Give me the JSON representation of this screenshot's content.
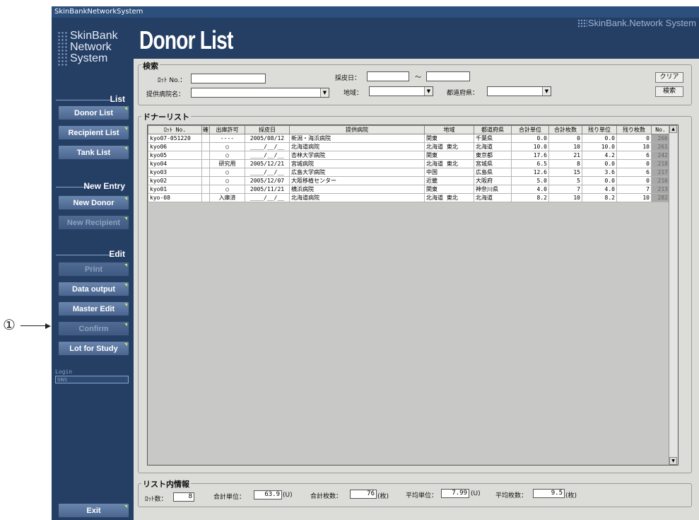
{
  "window": {
    "title": "SkinBankNetworkSystem"
  },
  "sidebar": {
    "logo": [
      "SkinBank",
      "Network",
      "System"
    ],
    "sections": {
      "list": "List",
      "new_entry": "New Entry",
      "edit": "Edit"
    },
    "buttons": {
      "donor_list": "Donor List",
      "recipient_list": "Recipient List",
      "tank_list": "Tank List",
      "new_donor": "New Donor",
      "new_recipient": "New Recipient",
      "print": "Print",
      "data_output": "Data output",
      "master_edit": "Master Edit",
      "confirm": "Confirm",
      "lot_for_study": "Lot for Study",
      "exit": "Exit"
    },
    "login_label": "Login",
    "login_value": "SNS"
  },
  "annotation": {
    "marker": "①"
  },
  "header": {
    "title": "Donor List",
    "brand": "SkinBank.Network System"
  },
  "search": {
    "group_label": "検索",
    "lot_label": "ﾛｯﾄ No.：",
    "lot_value": "",
    "date_label": "採皮日：",
    "date_from": "",
    "date_sep": "～",
    "date_to": "",
    "hospital_label": "提供病院名：",
    "hospital_value": "",
    "region_label": "地域：",
    "region_value": "",
    "prefecture_label": "都道府県：",
    "prefecture_value": "",
    "clear_button": "クリア",
    "search_button": "検索"
  },
  "list": {
    "group_label": "ドナーリスト",
    "columns": [
      "ﾛｯﾄ No.",
      "確",
      "出庫許可",
      "採皮日",
      "提供病院",
      "地域",
      "都道府県",
      "合計単位",
      "合計枚数",
      "残り単位",
      "残り枚数",
      "No."
    ],
    "rows": [
      [
        "kyo07-051220",
        "",
        "----",
        "2005/08/12",
        "新潟・海浜病院",
        "関東",
        "千葉県",
        "0.0",
        "0",
        "0.0",
        "0",
        "266"
      ],
      [
        "kyo06",
        "",
        "○",
        "____/__/__",
        "北海道病院",
        "北海道 東北",
        "北海道",
        "10.0",
        "10",
        "10.0",
        "10",
        "261"
      ],
      [
        "kyo05",
        "",
        "○",
        "____/__/__",
        "杏林大学病院",
        "関東",
        "東京都",
        "17.6",
        "21",
        "4.2",
        "6",
        "242"
      ],
      [
        "kyo04",
        "",
        "研究用",
        "2005/12/21",
        "宮城病院",
        "北海道 東北",
        "宮城県",
        "6.5",
        "8",
        "0.0",
        "0",
        "218"
      ],
      [
        "kyo03",
        "",
        "○",
        "____/__/__",
        "広島大学病院",
        "中国",
        "広島県",
        "12.6",
        "15",
        "3.6",
        "6",
        "217"
      ],
      [
        "kyo02",
        "",
        "○",
        "2005/12/07",
        "大阪移植センター",
        "近畿",
        "大阪府",
        "5.0",
        "5",
        "0.0",
        "0",
        "216"
      ],
      [
        "kyo01",
        "",
        "○",
        "2005/11/21",
        "横浜病院",
        "関東",
        "神奈川県",
        "4.0",
        "7",
        "4.0",
        "7",
        "213"
      ],
      [
        "kyo-08",
        "",
        "入庫済",
        "____/__/__",
        "北海道病院",
        "北海道 東北",
        "北海道",
        "8.2",
        "10",
        "8.2",
        "10",
        "282"
      ]
    ]
  },
  "info": {
    "group_label": "リスト内情報",
    "lot_count_label": "ﾛｯﾄ数：",
    "lot_count": "8",
    "total_units_label": "合計単位：",
    "total_units": "63.9",
    "total_units_unit": "(U)",
    "total_sheets_label": "合計枚数：",
    "total_sheets": "76",
    "total_sheets_unit": "(枚)",
    "avg_units_label": "平均単位：",
    "avg_units": "7.99",
    "avg_units_unit": "(U)",
    "avg_sheets_label": "平均枚数：",
    "avg_sheets": "9.5",
    "avg_sheets_unit": "(枚)"
  }
}
